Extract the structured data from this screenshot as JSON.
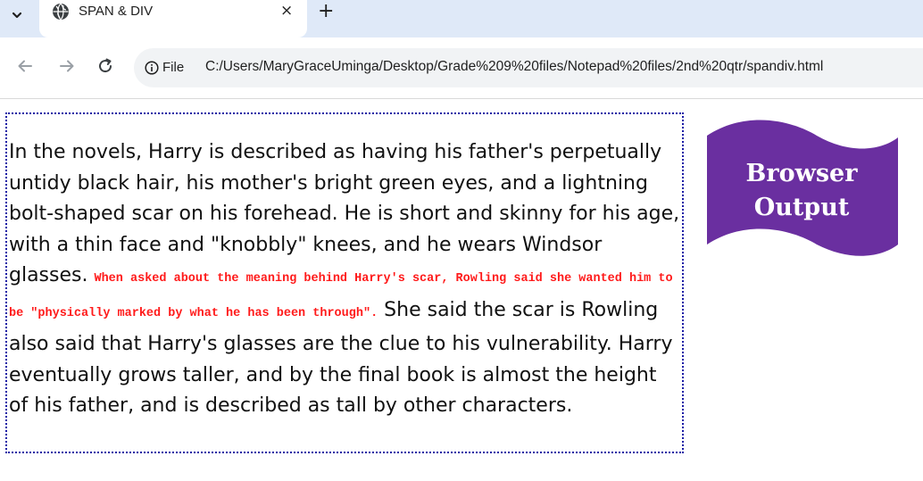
{
  "browser": {
    "tab": {
      "title": "SPAN & DIV",
      "close_glyph": "×",
      "icon": "globe-icon"
    },
    "new_tab_glyph": "+",
    "site_info_label": "File",
    "url": "C:/Users/MaryGraceUminga/Desktop/Grade%209%20files/Notepad%20files/2nd%20qtr/spandiv.html"
  },
  "page": {
    "paragraph_before": "In the novels, Harry is described as having his father's perpetually untidy black hair, his mother's bright green eyes, and a lightning bolt-shaped scar on his forehead. He is short and skinny for his age, with a thin face and \"knobbly\" knees, and he wears Windsor glasses.",
    "span_text": "When asked about the meaning behind Harry's scar, Rowling said she wanted him to be \"physically marked by what he has been through\".",
    "paragraph_after": "She said the scar is Rowling also said that Harry's glasses are the clue to his vulnerability. Harry eventually grows taller, and by the final book is almost the height of his father, and is described as tall by other characters."
  },
  "banner": {
    "line1": "Browser",
    "line2": "Output",
    "color": "#6a2fa0"
  },
  "colors": {
    "tabstrip": "#dfe9f8",
    "div_border": "#1a1aa6",
    "span_text": "#ff1a1a"
  }
}
